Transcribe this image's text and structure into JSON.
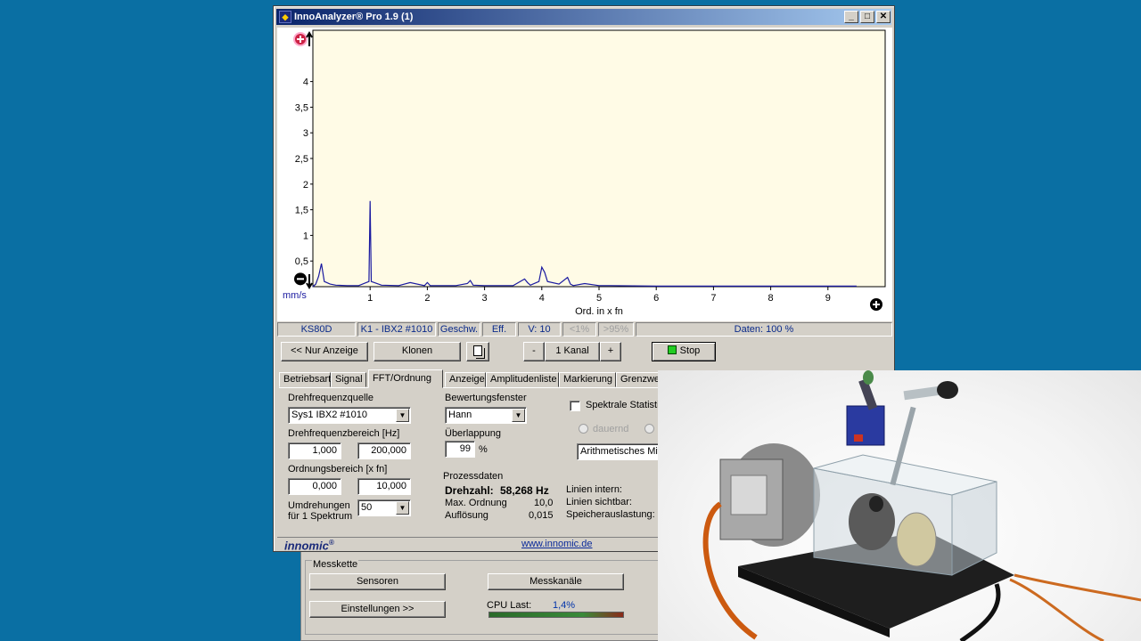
{
  "window": {
    "title": "InnoAnalyzer® Pro 1.9 (1)",
    "buttons": [
      "_",
      "□",
      "✕"
    ]
  },
  "chart_data": {
    "type": "line",
    "xlabel": "Ord. in x fn",
    "ylabel": "mm/s",
    "xlim": [
      0,
      10
    ],
    "ylim": [
      0,
      5
    ],
    "xticks": [
      "1",
      "2",
      "3",
      "4",
      "5",
      "6",
      "7",
      "8",
      "9"
    ],
    "yticks": [
      "0,5",
      "1",
      "1,5",
      "2",
      "2,5",
      "3",
      "3,5",
      "4"
    ],
    "series": [
      {
        "color": "#1a1aa0",
        "x": [
          0.0,
          0.05,
          0.1,
          0.15,
          0.2,
          0.3,
          0.4,
          0.6,
          0.8,
          0.98,
          1.0,
          1.02,
          1.2,
          1.5,
          1.7,
          1.95,
          2.0,
          2.05,
          2.5,
          2.7,
          2.75,
          2.8,
          3.0,
          3.2,
          3.5,
          3.7,
          3.75,
          3.8,
          3.95,
          4.0,
          4.05,
          4.1,
          4.3,
          4.45,
          4.5,
          4.55,
          4.75,
          5.0,
          5.2,
          6.0,
          7.0,
          8.0,
          9.0,
          9.5
        ],
        "y": [
          0.0,
          0.05,
          0.2,
          0.45,
          0.1,
          0.05,
          0.03,
          0.02,
          0.02,
          0.1,
          1.67,
          0.1,
          0.03,
          0.02,
          0.08,
          0.02,
          0.08,
          0.02,
          0.02,
          0.06,
          0.12,
          0.03,
          0.02,
          0.02,
          0.02,
          0.15,
          0.08,
          0.03,
          0.1,
          0.38,
          0.28,
          0.1,
          0.05,
          0.18,
          0.05,
          0.02,
          0.06,
          0.02,
          0.02,
          0.01,
          0.01,
          0.01,
          0.01,
          0.01
        ]
      }
    ]
  },
  "status": {
    "sensor": "KS80D",
    "channel": "K1 - IBX2 #1010",
    "mode": "Geschw.",
    "eff": "Eff.",
    "v": "V: 10",
    "lt1": "<1%",
    "gt95": ">95%",
    "daten": "Daten: 100 %"
  },
  "toolbar": {
    "nur_anzeige": "<< Nur Anzeige",
    "klonen": "Klonen",
    "minus": "-",
    "kanal": "1 Kanal",
    "plus": "+",
    "stop": "Stop"
  },
  "tabs": [
    "Betriebsart",
    "Signal",
    "FFT/Ordnung",
    "Anzeige",
    "Amplitudenliste",
    "Markierung",
    "Grenzwe"
  ],
  "panel": {
    "drehfrequenzquelle_label": "Drehfrequenzquelle",
    "drehfrequenzquelle_value": "Sys1 IBX2 #1010",
    "drehfrequenzbereich_label": "Drehfrequenzbereich [Hz]",
    "df_min": "1,000",
    "df_max": "200,000",
    "ordnungsbereich_label": "Ordnungsbereich [x fn]",
    "ord_min": "0,000",
    "ord_max": "10,000",
    "umdrehungen_label1": "Umdrehungen",
    "umdrehungen_label2": "für 1 Spektrum",
    "umdrehungen_value": "50",
    "bewertungsfenster_label": "Bewertungsfenster",
    "bewertungsfenster_value": "Hann",
    "ueberlappung_label": "Überlappung",
    "ueberlappung_value": "99",
    "percent": "%",
    "spektrale_label": "Spektrale Statistik",
    "dauernd": "dauernd",
    "arith": "Arithmetisches Mitt",
    "prozessdaten": "Prozessdaten",
    "drehzahl_label": "Drehzahl:",
    "drehzahl_value": "58,268 Hz",
    "max_ordnung_label": "Max. Ordnung",
    "max_ordnung_value": "10,0",
    "aufloesung_label": "Auflösung",
    "aufloesung_value": "0,015",
    "linien_intern": "Linien intern:",
    "linien_sichtbar": "Linien sichtbar:",
    "speicher": "Speicherauslastung:"
  },
  "footer": {
    "logo": "innomic",
    "reg": "®",
    "link": "www.innomic.de"
  },
  "back": {
    "messkette": "Messkette",
    "sensoren": "Sensoren",
    "messkanaele": "Messkanäle",
    "einstellungen": "Einstellungen >>",
    "cpu_label": "CPU Last:",
    "cpu_value": "1,4%"
  }
}
